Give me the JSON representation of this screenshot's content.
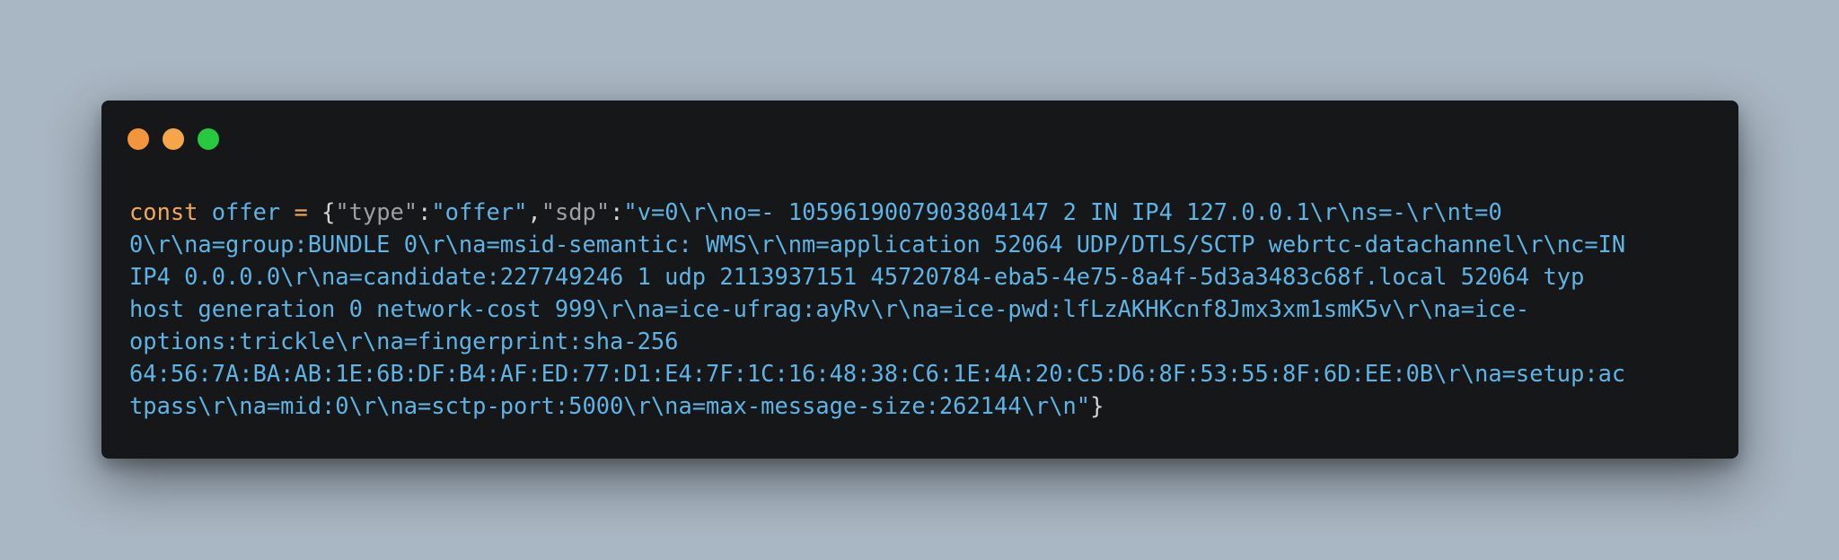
{
  "window": {
    "controls": [
      {
        "name": "close",
        "color": "#f3953a"
      },
      {
        "name": "minimize",
        "color": "#f5a54a"
      },
      {
        "name": "zoom",
        "color": "#27c93f"
      }
    ]
  },
  "colors": {
    "keyword": "#f2a857",
    "identifier": "#5eb4e5",
    "operator": "#f2a857",
    "punctuation": "#d4d4d4",
    "key": "#9aa0a6",
    "string": "#5eb4e5"
  },
  "code": {
    "lines": [
      [
        {
          "t": "keyword",
          "v": "const"
        },
        {
          "t": "space",
          "v": " "
        },
        {
          "t": "identifier",
          "v": "offer"
        },
        {
          "t": "space",
          "v": " "
        },
        {
          "t": "operator",
          "v": "="
        },
        {
          "t": "space",
          "v": " "
        },
        {
          "t": "punctuation",
          "v": "{"
        },
        {
          "t": "key",
          "v": "\"type\""
        },
        {
          "t": "punctuation",
          "v": ":"
        },
        {
          "t": "string",
          "v": "\"offer\""
        },
        {
          "t": "punctuation",
          "v": ","
        },
        {
          "t": "key",
          "v": "\"sdp\""
        },
        {
          "t": "punctuation",
          "v": ":"
        },
        {
          "t": "string",
          "v": "\"v=0\\r\\no=- 1059619007903804147 2 IN IP4 127.0.0.1\\r\\ns=-\\r\\nt=0"
        }
      ],
      [
        {
          "t": "string",
          "v": "0\\r\\na=group:BUNDLE 0\\r\\na=msid-semantic: WMS\\r\\nm=application 52064 UDP/DTLS/SCTP webrtc-datachannel\\r\\nc=IN"
        }
      ],
      [
        {
          "t": "string",
          "v": "IP4 0.0.0.0\\r\\na=candidate:227749246 1 udp 2113937151 45720784-eba5-4e75-8a4f-5d3a3483c68f.local 52064 typ"
        }
      ],
      [
        {
          "t": "string",
          "v": "host generation 0 network-cost 999\\r\\na=ice-ufrag:ayRv\\r\\na=ice-pwd:lfLzAKHKcnf8Jmx3xm1smK5v\\r\\na=ice-"
        }
      ],
      [
        {
          "t": "string",
          "v": "options:trickle\\r\\na=fingerprint:sha-256"
        }
      ],
      [
        {
          "t": "string",
          "v": "64:56:7A:BA:AB:1E:6B:DF:B4:AF:ED:77:D1:E4:7F:1C:16:48:38:C6:1E:4A:20:C5:D6:8F:53:55:8F:6D:EE:0B\\r\\na=setup:ac"
        }
      ],
      [
        {
          "t": "string",
          "v": "tpass\\r\\na=mid:0\\r\\na=sctp-port:5000\\r\\na=max-message-size:262144\\r\\n\""
        },
        {
          "t": "punctuation",
          "v": "}"
        }
      ]
    ]
  }
}
